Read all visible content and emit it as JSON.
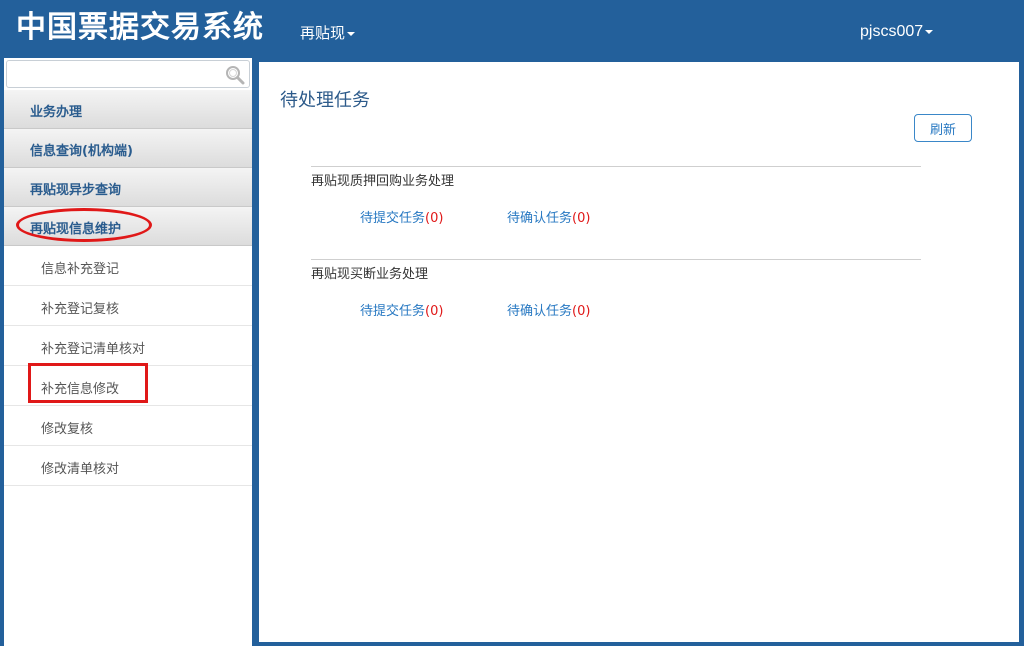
{
  "header": {
    "app_title": "中国票据交易系统",
    "nav_menu": "再贴现",
    "user": "pjscs007"
  },
  "sidebar": {
    "search_placeholder": "",
    "groups": [
      {
        "label": "业务办理"
      },
      {
        "label": "信息查询(机构端)"
      },
      {
        "label": "再贴现异步查询"
      },
      {
        "label": "再贴现信息维护"
      }
    ],
    "items": [
      {
        "label": "信息补充登记"
      },
      {
        "label": "补充登记复核"
      },
      {
        "label": "补充登记清单核对"
      },
      {
        "label": "补充信息修改"
      },
      {
        "label": "修改复核"
      },
      {
        "label": "修改清单核对"
      }
    ]
  },
  "main": {
    "title": "待处理任务",
    "refresh_label": "刷新",
    "sections": [
      {
        "title": "再贴现质押回购业务处理",
        "links": [
          {
            "label": "待提交任务",
            "count": "(0)"
          },
          {
            "label": "待确认任务",
            "count": "(0)"
          }
        ]
      },
      {
        "title": "再贴现买断业务处理",
        "links": [
          {
            "label": "待提交任务",
            "count": "(0)"
          },
          {
            "label": "待确认任务",
            "count": "(0)"
          }
        ]
      }
    ]
  },
  "colors": {
    "brand": "#23609b",
    "highlight": "#e01818",
    "link": "#2778c2"
  },
  "icons": [
    "search-icon",
    "caret-down-icon"
  ]
}
